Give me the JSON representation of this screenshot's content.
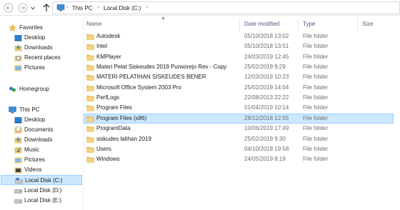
{
  "window": {
    "accent": "#cce8ff",
    "accent_border": "#99d1ff"
  },
  "nav": {
    "back_icon": "back-arrow-icon",
    "forward_icon": "forward-arrow-icon",
    "up_icon": "up-arrow-icon",
    "breadcrumb": [
      "This PC",
      "Local Disk (C:)"
    ],
    "separator": "›"
  },
  "sidebar": {
    "favorites": {
      "label": "Favorites",
      "items": [
        "Desktop",
        "Downloads",
        "Recent places",
        "Pictures"
      ]
    },
    "homegroup": {
      "label": "Homegroup"
    },
    "this_pc": {
      "label": "This PC",
      "items": [
        "Desktop",
        "Documents",
        "Downloads",
        "Music",
        "Pictures",
        "Videos",
        "Local Disk (C:)",
        "Local Disk (D:)",
        "Local Disk (E:)"
      ],
      "selected": "Local Disk (C:)"
    }
  },
  "columns": {
    "name": "Name",
    "date": "Date modified",
    "type": "Type",
    "size": "Size"
  },
  "files": [
    {
      "name": "Autodesk",
      "date": "05/10/2018 13:02",
      "type": "File folder"
    },
    {
      "name": "Intel",
      "date": "05/10/2018 13:51",
      "type": "File folder"
    },
    {
      "name": "KMPlayer",
      "date": "24/03/2019 12:45",
      "type": "File folder"
    },
    {
      "name": "Materi Pelat Siskeudes 2019 Purworejo Rev - Copy",
      "date": "25/02/2019 9:29",
      "type": "File folder"
    },
    {
      "name": "MATERI PELATIHAN SISKEUDES BENER",
      "date": "12/03/2019 10:23",
      "type": "File folder"
    },
    {
      "name": "Microsoft  Office System 2003 Pro",
      "date": "25/02/2019 14:04",
      "type": "File folder"
    },
    {
      "name": "PerfLogs",
      "date": "22/08/2013 22:22",
      "type": "File folder"
    },
    {
      "name": "Program Files",
      "date": "01/04/2019 10:14",
      "type": "File folder"
    },
    {
      "name": "Program Files (x86)",
      "date": "28/12/2018 12:55",
      "type": "File folder",
      "selected": true
    },
    {
      "name": "ProgramData",
      "date": "10/06/2019 17:49",
      "type": "File folder"
    },
    {
      "name": "siskudes latihan 2019",
      "date": "25/02/2019 9:30",
      "type": "File folder"
    },
    {
      "name": "Users",
      "date": "04/10/2018 19:58",
      "type": "File folder"
    },
    {
      "name": "Windows",
      "date": "24/05/2019 8:19",
      "type": "File folder"
    }
  ]
}
